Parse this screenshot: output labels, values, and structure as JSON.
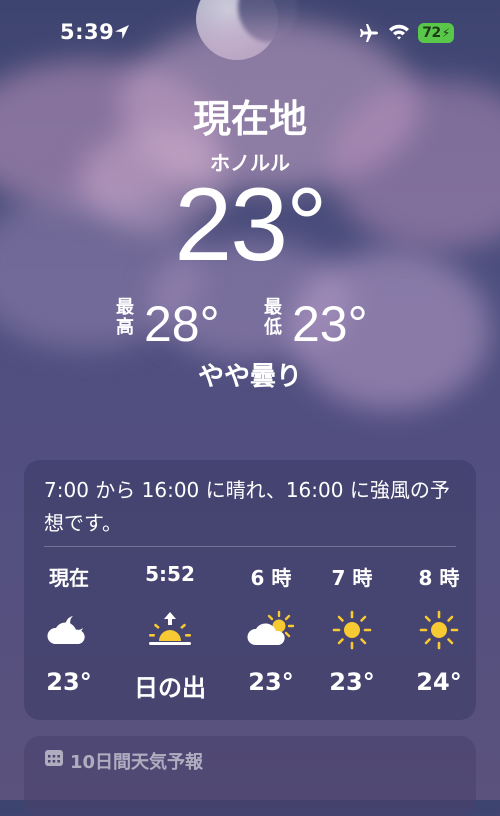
{
  "status_bar": {
    "time": "5:39",
    "battery": "72"
  },
  "hero": {
    "location_title": "現在地",
    "city": "ホノルル",
    "temperature": "23°",
    "high_label": "最高",
    "high_value": "28°",
    "low_label": "最低",
    "low_value": "23°",
    "condition": "やや曇り"
  },
  "hourly_card": {
    "summary": "7:00 から 16:00 に晴れ、16:00 に強風の予想です。",
    "hours": [
      {
        "label": "現在",
        "icon": "partly-cloudy-night-icon",
        "temp": "23°"
      },
      {
        "label": "5:52",
        "icon": "sunrise-icon",
        "temp": "日の出"
      },
      {
        "label": "6 時",
        "icon": "partly-sunny-icon",
        "temp": "23°"
      },
      {
        "label": "7 時",
        "icon": "sun-icon",
        "temp": "23°"
      },
      {
        "label": "8 時",
        "icon": "sun-icon",
        "temp": "24°"
      }
    ]
  },
  "ten_day_card": {
    "title": "10日間天気予報"
  },
  "colors": {
    "sun_yellow": "#f7c932",
    "battery_green": "#59c84a"
  }
}
